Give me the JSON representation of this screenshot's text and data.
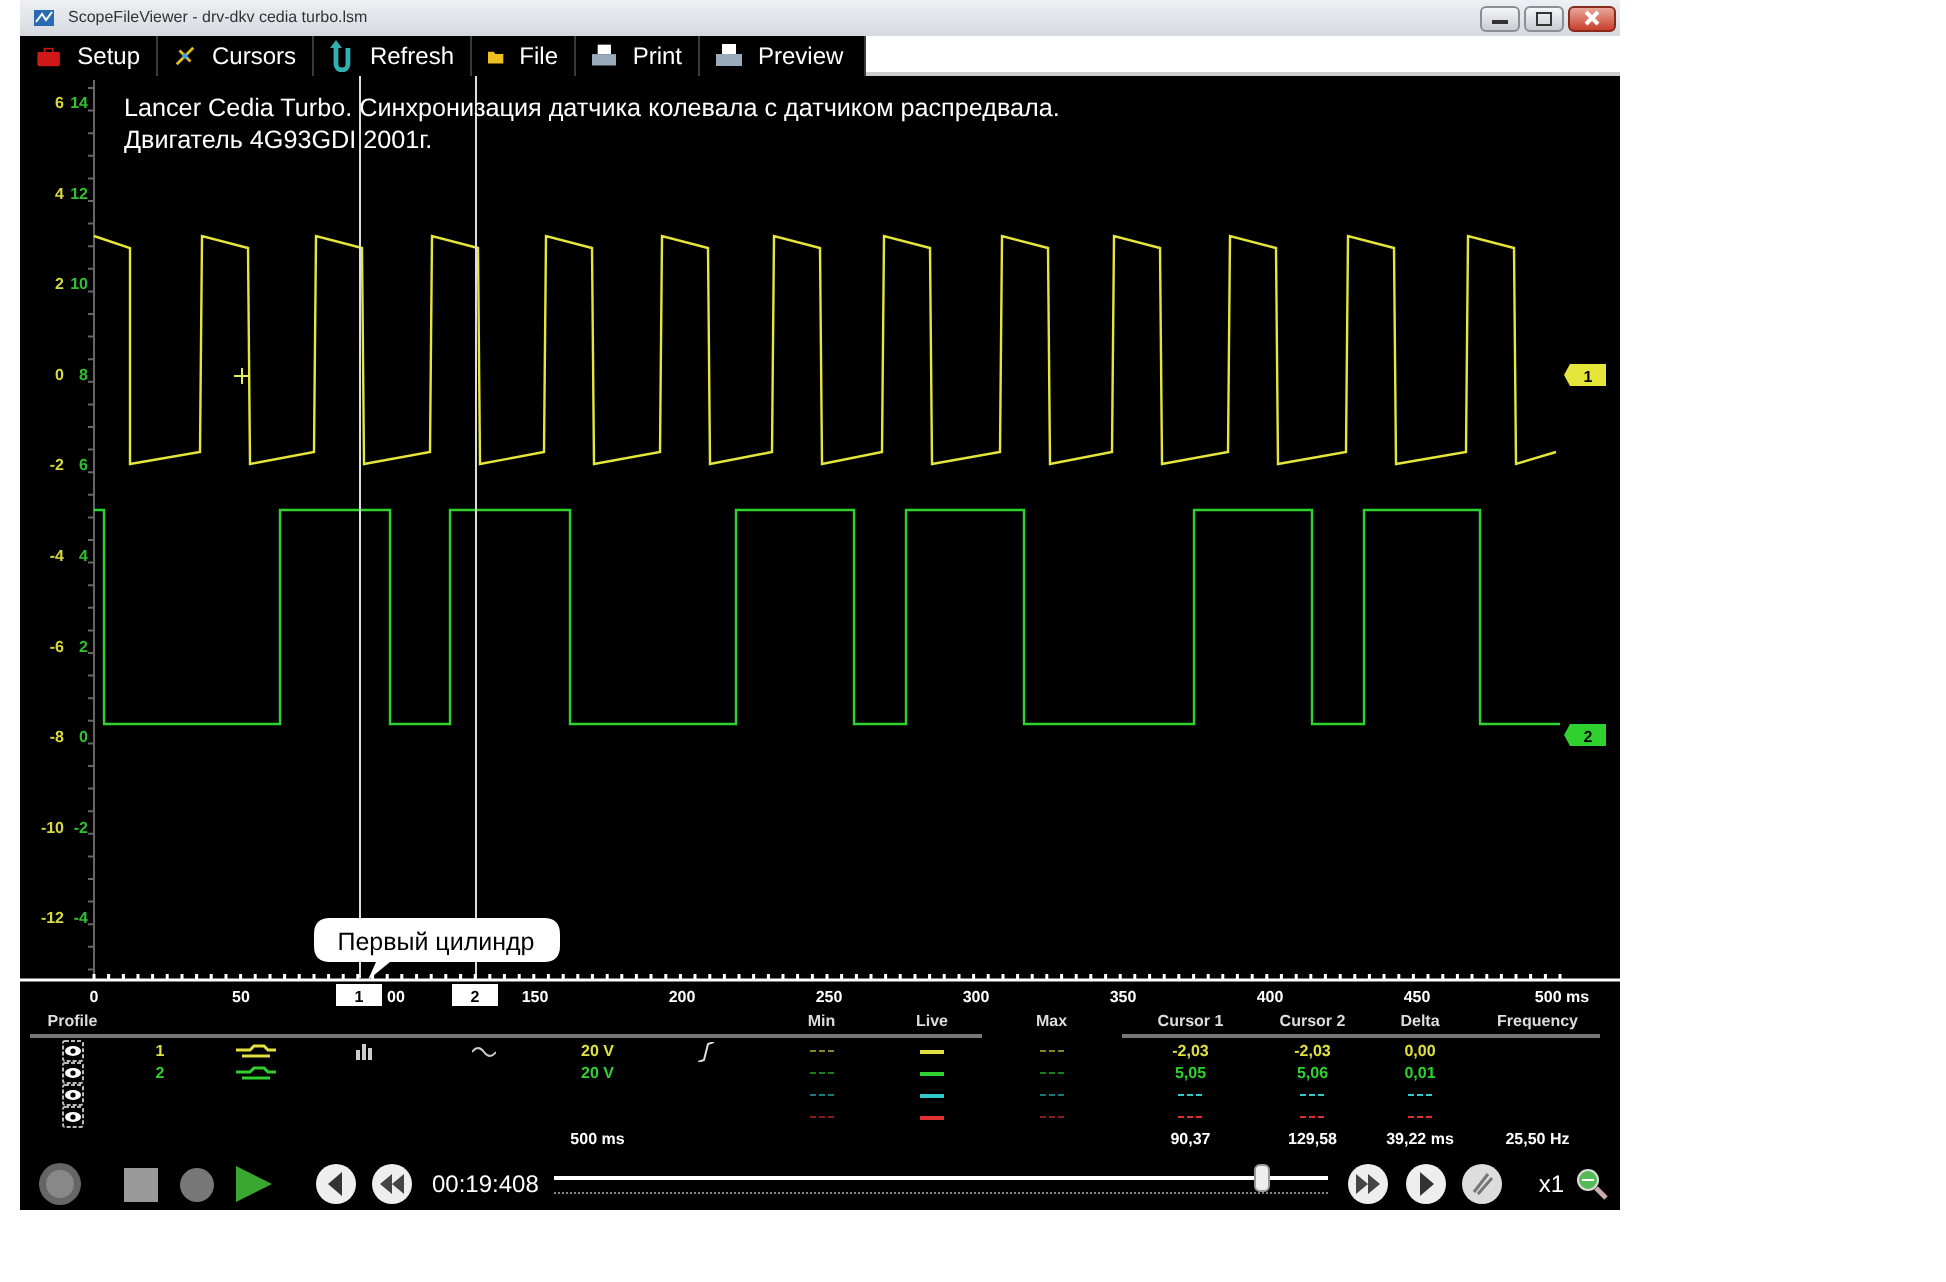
{
  "window": {
    "title": "ScopeFileViewer - drv-dkv cedia turbo.lsm"
  },
  "toolbar": [
    {
      "label": "Setup"
    },
    {
      "label": "Cursors"
    },
    {
      "label": "Refresh"
    },
    {
      "label": "File"
    },
    {
      "label": "Print"
    },
    {
      "label": "Preview"
    }
  ],
  "plot": {
    "note": [
      "Lancer Cedia Turbo. Синхронизация датчика колевала с датчиком распредвала.",
      "Двигатель 4G93GDI 2001г."
    ],
    "axis_1": [
      "6",
      "4",
      "2",
      "0",
      "-2",
      "-4",
      "-6",
      "-8",
      "-10",
      "-12"
    ],
    "axis_2": [
      "14",
      "12",
      "10",
      "8",
      "6",
      "4",
      "2",
      "0",
      "-2",
      "-4"
    ],
    "channel_markers": [
      {
        "label": "1",
        "color": "#e6e63a"
      },
      {
        "label": "2",
        "color": "#2ed12e"
      }
    ],
    "callout": "Первый цилиндр",
    "cursors": [
      {
        "label": "1"
      },
      {
        "label": "2"
      }
    ],
    "x_ticks": [
      "0",
      "50",
      "00",
      "150",
      "200",
      "250",
      "300",
      "350",
      "400",
      "450",
      "500 ms"
    ]
  },
  "profile": {
    "title": "Profile",
    "headers_1": [
      "Min",
      "Live",
      "Max"
    ],
    "headers_2": [
      "Cursor 1",
      "Cursor 2",
      "Delta",
      "Frequency"
    ],
    "channels": [
      {
        "number": "1",
        "color": "#e0e040",
        "probe": true,
        "selected": true,
        "range": "20 V",
        "cursor_1": "-2,03",
        "cursor_2": "-2,03",
        "delta": "0,00"
      },
      {
        "number": "2",
        "color": "#30d030",
        "probe": true,
        "selected": false,
        "range": "20 V",
        "cursor_1": "5,05",
        "cursor_2": "5,06",
        "delta": "0,01"
      },
      {
        "color": "#30c8c8",
        "probe": false,
        "selected": false
      },
      {
        "color": "#e03030",
        "probe": false,
        "selected": false
      }
    ],
    "timebase": "500 ms",
    "cursor_1": "90,37",
    "cursor_2": "129,58",
    "delta": "39,22 ms",
    "frequency": "25,50 Hz"
  },
  "playback": {
    "time": "00:19:408",
    "position": {
      "level": 0.915
    },
    "speed": "x1"
  }
}
